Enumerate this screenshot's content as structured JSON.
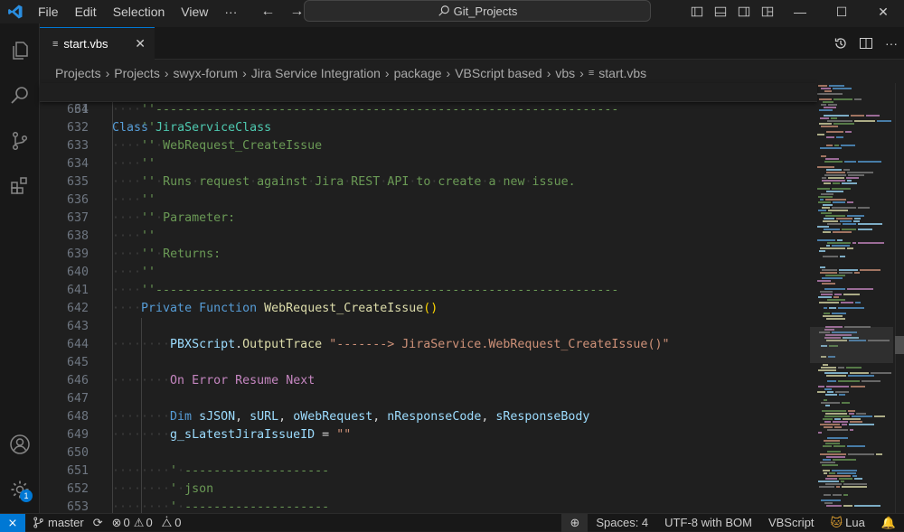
{
  "titlebar": {
    "menu": [
      "File",
      "Edit",
      "Selection",
      "View",
      "···"
    ],
    "search_text": "Git_Projects"
  },
  "tab": {
    "label": "start.vbs",
    "icon": "vbs-file-icon"
  },
  "breadcrumb": [
    "Projects",
    "Projects",
    "swyx-forum",
    "Jira Service Integration",
    "package",
    "VBScript based",
    "vbs",
    "start.vbs"
  ],
  "sticky": {
    "line": "64",
    "keyword": "Class",
    "name": "JiraServiceClass"
  },
  "lines": [
    {
      "n": "631",
      "ind": 4,
      "tokens": [
        [
          "cm",
          "''----------------------------------------------------------------"
        ]
      ]
    },
    {
      "n": "632",
      "ind": 4,
      "tokens": [
        [
          "cm",
          "''"
        ]
      ]
    },
    {
      "n": "633",
      "ind": 4,
      "tokens": [
        [
          "cm",
          "'' WebRequest_CreateIssue"
        ]
      ]
    },
    {
      "n": "634",
      "ind": 4,
      "tokens": [
        [
          "cm",
          "''"
        ]
      ]
    },
    {
      "n": "635",
      "ind": 4,
      "tokens": [
        [
          "cm",
          "'' Runs request against Jira REST API to create a new issue."
        ]
      ]
    },
    {
      "n": "636",
      "ind": 4,
      "tokens": [
        [
          "cm",
          "''"
        ]
      ]
    },
    {
      "n": "637",
      "ind": 4,
      "tokens": [
        [
          "cm",
          "'' Parameter:"
        ]
      ]
    },
    {
      "n": "638",
      "ind": 4,
      "tokens": [
        [
          "cm",
          "''"
        ]
      ]
    },
    {
      "n": "639",
      "ind": 4,
      "tokens": [
        [
          "cm",
          "'' Returns:"
        ]
      ]
    },
    {
      "n": "640",
      "ind": 4,
      "tokens": [
        [
          "cm",
          "''"
        ]
      ]
    },
    {
      "n": "641",
      "ind": 4,
      "tokens": [
        [
          "cm",
          "''----------------------------------------------------------------"
        ]
      ]
    },
    {
      "n": "642",
      "ind": 4,
      "tokens": [
        [
          "kw",
          "Private"
        ],
        [
          "pn",
          " "
        ],
        [
          "kw",
          "Function"
        ],
        [
          "pn",
          " "
        ],
        [
          "fn",
          "WebRequest_CreateIssue"
        ],
        [
          "pn2",
          "()"
        ]
      ]
    },
    {
      "n": "643",
      "ind": 0,
      "tokens": []
    },
    {
      "n": "644",
      "ind": 8,
      "tokens": [
        [
          "var",
          "PBXScript"
        ],
        [
          "pn",
          "."
        ],
        [
          "fn",
          "OutputTrace"
        ],
        [
          "pn",
          " "
        ],
        [
          "str",
          "\"-------> JiraService.WebRequest_CreateIssue()\""
        ]
      ]
    },
    {
      "n": "645",
      "ind": 0,
      "tokens": []
    },
    {
      "n": "646",
      "ind": 8,
      "tokens": [
        [
          "kwp",
          "On"
        ],
        [
          "pn",
          " "
        ],
        [
          "kwp",
          "Error"
        ],
        [
          "pn",
          " "
        ],
        [
          "kwp",
          "Resume"
        ],
        [
          "pn",
          " "
        ],
        [
          "kwp",
          "Next"
        ]
      ]
    },
    {
      "n": "647",
      "ind": 0,
      "tokens": []
    },
    {
      "n": "648",
      "ind": 8,
      "tokens": [
        [
          "kw",
          "Dim"
        ],
        [
          "pn",
          " "
        ],
        [
          "var",
          "sJSON"
        ],
        [
          "pn",
          ", "
        ],
        [
          "var",
          "sURL"
        ],
        [
          "pn",
          ", "
        ],
        [
          "var",
          "oWebRequest"
        ],
        [
          "pn",
          ", "
        ],
        [
          "var",
          "nResponseCode"
        ],
        [
          "pn",
          ", "
        ],
        [
          "var",
          "sResponseBody"
        ]
      ]
    },
    {
      "n": "649",
      "ind": 8,
      "tokens": [
        [
          "var",
          "g_sLatestJiraIssueID"
        ],
        [
          "pn",
          " = "
        ],
        [
          "str",
          "\"\""
        ]
      ]
    },
    {
      "n": "650",
      "ind": 0,
      "tokens": []
    },
    {
      "n": "651",
      "ind": 8,
      "tokens": [
        [
          "cm",
          "' --------------------"
        ]
      ]
    },
    {
      "n": "652",
      "ind": 8,
      "tokens": [
        [
          "cm",
          "' json"
        ]
      ]
    },
    {
      "n": "653",
      "ind": 8,
      "tokens": [
        [
          "cm",
          "' --------------------"
        ]
      ]
    }
  ],
  "statusbar": {
    "branch": "master",
    "errors": "0",
    "warnings": "0",
    "info": "0",
    "spaces": "Spaces: 4",
    "encoding": "UTF-8 with BOM",
    "language": "VBScript",
    "lua": "Lua"
  },
  "activity_badge": "1",
  "colors": {
    "accent": "#0078d4",
    "comment": "#6a9955",
    "keyword": "#569cd6",
    "control": "#c586c0",
    "function": "#dcdcaa",
    "variable": "#9cdcfe",
    "string": "#ce9178",
    "class": "#4ec9b0"
  }
}
